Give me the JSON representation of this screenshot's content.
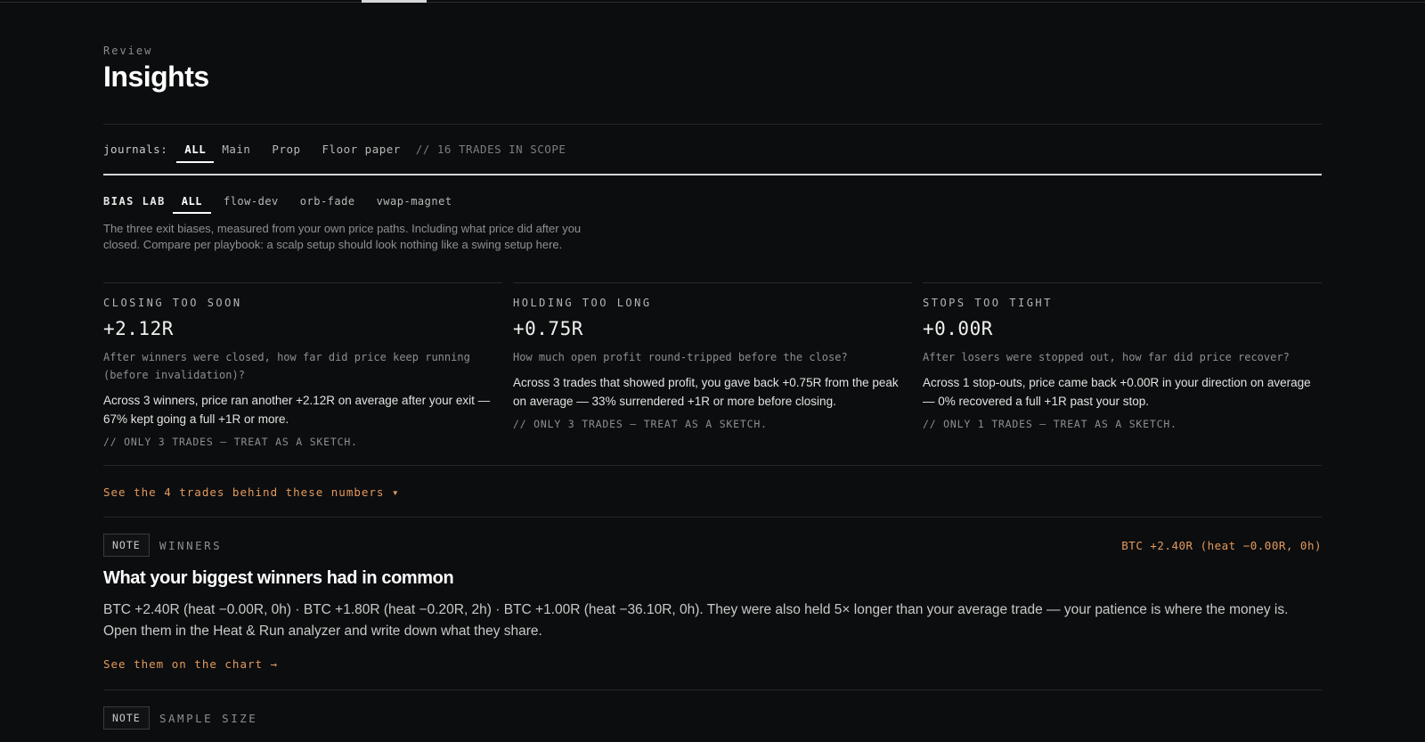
{
  "header": {
    "eyebrow": "Review",
    "title": "Insights"
  },
  "journals": {
    "label": "journals:",
    "tabs": [
      {
        "label": "ALL",
        "active": true
      },
      {
        "label": "Main",
        "active": false
      },
      {
        "label": "Prop",
        "active": false
      },
      {
        "label": "Floor paper",
        "active": false
      }
    ],
    "scope": "// 16 TRADES IN SCOPE"
  },
  "bias_lab": {
    "label": "BIAS LAB",
    "tabs": [
      {
        "label": "ALL",
        "active": true
      },
      {
        "label": "flow-dev",
        "active": false
      },
      {
        "label": "orb-fade",
        "active": false
      },
      {
        "label": "vwap-magnet",
        "active": false
      }
    ],
    "description": "The three exit biases, measured from your own price paths. Including what price did after you closed. Compare per playbook: a scalp setup should look nothing like a swing setup here."
  },
  "cards": [
    {
      "title": "CLOSING TOO SOON",
      "value": "+2.12R",
      "question": "After winners were closed, how far did price keep running (before invalidation)?",
      "body": "Across 3 winners, price ran another +2.12R on average after your exit — 67% kept going a full +1R or more.",
      "note": "// ONLY 3 TRADES — TREAT AS A SKETCH."
    },
    {
      "title": "HOLDING TOO LONG",
      "value": "+0.75R",
      "question": "How much open profit round-tripped before the close?",
      "body": "Across 3 trades that showed profit, you gave back +0.75R from the peak on average — 33% surrendered +1R or more before closing.",
      "note": "// ONLY 3 TRADES — TREAT AS A SKETCH."
    },
    {
      "title": "STOPS TOO TIGHT",
      "value": "+0.00R",
      "question": "After losers were stopped out, how far did price recover?",
      "body": "Across 1 stop-outs, price came back +0.00R in your direction on average — 0% recovered a full +1R past your stop.",
      "note": "// ONLY 1 TRADES — TREAT AS A SKETCH."
    }
  ],
  "see_trades": "See the 4 trades behind these numbers ▾",
  "notes": [
    {
      "badge": "NOTE",
      "tag": "WINNERS",
      "right": "BTC +2.40R (heat −0.00R, 0h)",
      "title": "What your biggest winners had in common",
      "body": "BTC +2.40R (heat −0.00R, 0h) · BTC +1.80R (heat −0.20R, 2h) · BTC +1.00R (heat −36.10R, 0h). They were also held 5× longer than your average trade — your patience is where the money is. Open them in the Heat & Run analyzer and write down what they share.",
      "link": "See them on the chart →"
    },
    {
      "badge": "NOTE",
      "tag": "SAMPLE SIZE"
    }
  ],
  "colors": {
    "background": "#0c0d0f",
    "accent": "#e39a5c",
    "text": "#e8e8e6",
    "muted": "#8d8e91"
  }
}
